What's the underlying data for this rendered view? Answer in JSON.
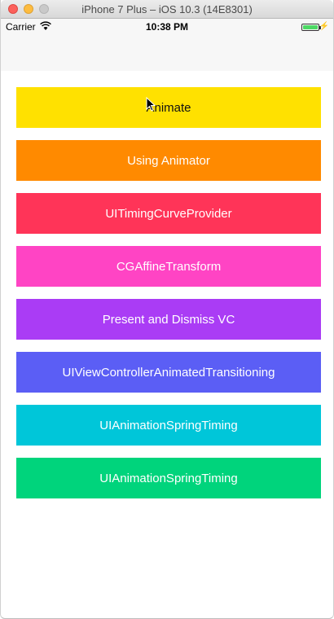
{
  "window": {
    "title": "iPhone 7 Plus – iOS 10.3 (14E8301)"
  },
  "status_bar": {
    "carrier": "Carrier",
    "time": "10:38 PM",
    "wifi_icon": "wifi-icon",
    "battery_icon": "battery-icon"
  },
  "buttons": [
    {
      "label": "Animate",
      "color": "#ffe100"
    },
    {
      "label": "Using Animator",
      "color": "#ff8a00"
    },
    {
      "label": "UITimingCurveProvider",
      "color": "#ff3458"
    },
    {
      "label": "CGAffineTransform",
      "color": "#ff44c4"
    },
    {
      "label": "Present and Dismiss VC",
      "color": "#aa3cf5"
    },
    {
      "label": "UIViewControllerAnimatedTransitioning",
      "color": "#5b5ef5"
    },
    {
      "label": "UIAnimationSpringTiming",
      "color": "#00c6d9"
    },
    {
      "label": "UIAnimationSpringTiming",
      "color": "#00d47c"
    }
  ]
}
